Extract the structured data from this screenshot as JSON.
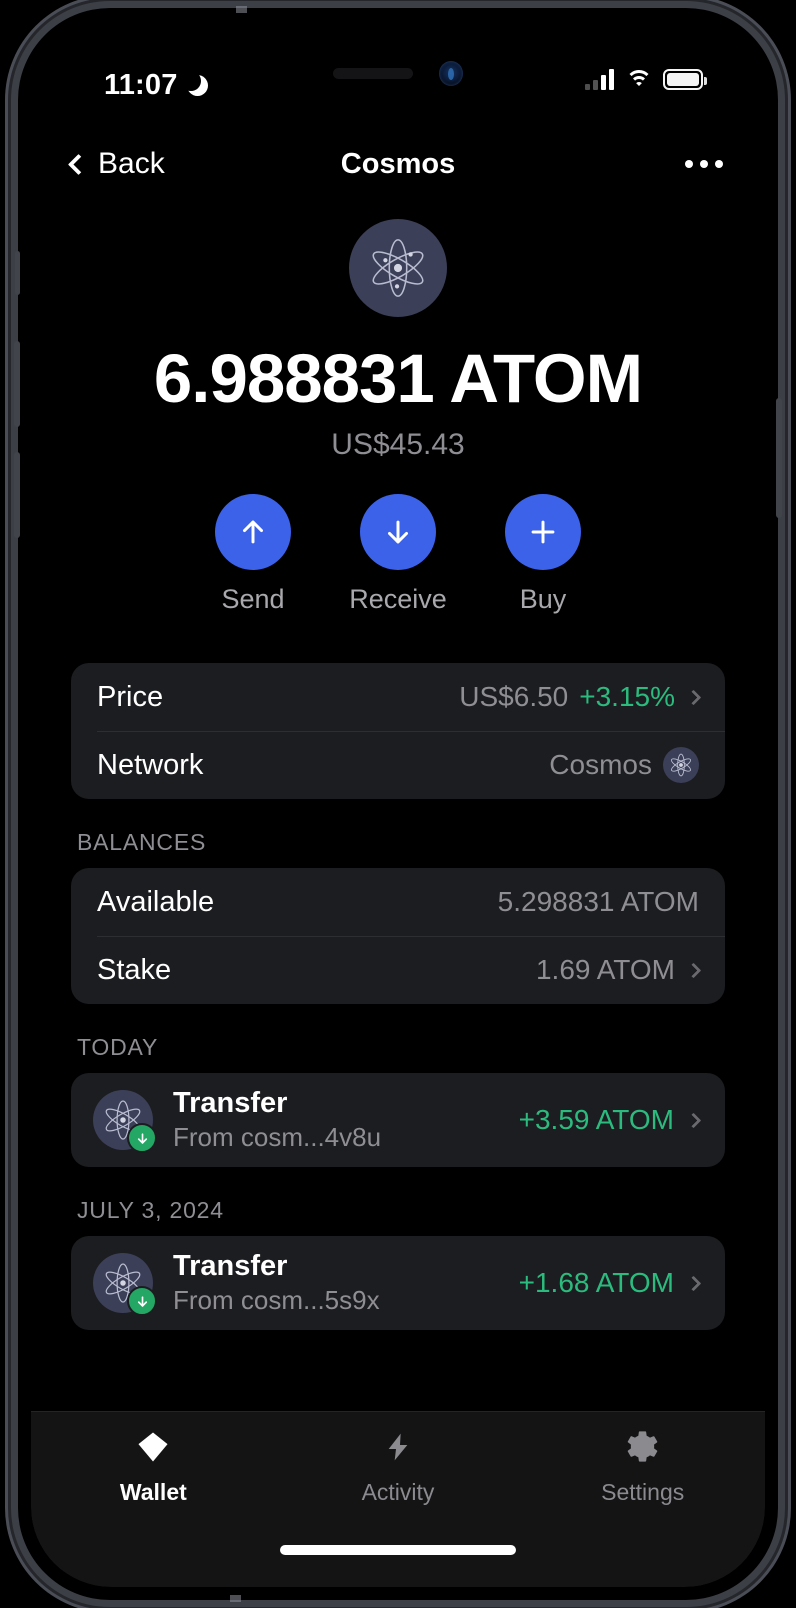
{
  "status_bar": {
    "time": "11:07",
    "dnd_icon": "moon-icon",
    "signal_icon": "cellular-signal-icon",
    "wifi_icon": "wifi-icon",
    "battery_icon": "battery-icon"
  },
  "nav": {
    "back_label": "Back",
    "title": "Cosmos",
    "more_icon": "overflow-menu-icon"
  },
  "header": {
    "coin_icon": "cosmos-atom-icon",
    "balance": "6.988831 ATOM",
    "fiat_value": "US$45.43"
  },
  "actions": [
    {
      "label": "Send",
      "icon": "arrow-up-icon"
    },
    {
      "label": "Receive",
      "icon": "arrow-down-icon"
    },
    {
      "label": "Buy",
      "icon": "plus-icon"
    }
  ],
  "info_card": {
    "price": {
      "label": "Price",
      "value": "US$6.50",
      "change": "+3.15%",
      "change_color": "#2cbb7e"
    },
    "network": {
      "label": "Network",
      "value": "Cosmos",
      "icon": "cosmos-atom-icon"
    }
  },
  "balances": {
    "section_label": "BALANCES",
    "rows": [
      {
        "label": "Available",
        "value": "5.298831 ATOM",
        "has_chevron": false
      },
      {
        "label": "Stake",
        "value": "1.69 ATOM",
        "has_chevron": true
      }
    ]
  },
  "transactions": [
    {
      "section_label": "TODAY",
      "title": "Transfer",
      "subtitle": "From cosm...4v8u",
      "amount": "+3.59 ATOM",
      "direction_icon": "arrow-down-badge-icon"
    },
    {
      "section_label": "JULY 3, 2024",
      "title": "Transfer",
      "subtitle": "From cosm...5s9x",
      "amount": "+1.68 ATOM",
      "direction_icon": "arrow-down-badge-icon"
    }
  ],
  "tabbar": [
    {
      "label": "Wallet",
      "icon": "gem-icon",
      "active": true
    },
    {
      "label": "Activity",
      "icon": "lightning-bolt-icon",
      "active": false
    },
    {
      "label": "Settings",
      "icon": "gear-icon",
      "active": false
    }
  ],
  "colors": {
    "accent_blue": "#3b62e8",
    "positive_green": "#2cbb7e",
    "card_bg": "#1c1d20",
    "screen_bg": "#000000"
  }
}
